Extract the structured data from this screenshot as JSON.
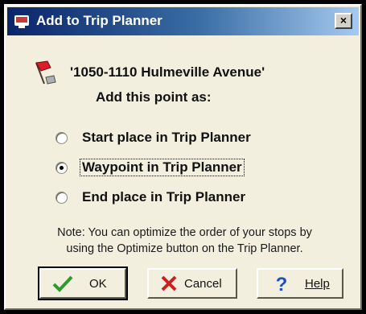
{
  "dialog": {
    "title": "Add to Trip Planner",
    "close_glyph": "×",
    "title_icon": "trip-planner-icon"
  },
  "location": {
    "address": "'1050-1110 Hulmeville Avenue'",
    "icon": "red-flag-icon"
  },
  "prompt": "Add this point as:",
  "options": [
    {
      "label": "Start place in Trip Planner",
      "selected": false
    },
    {
      "label": "Waypoint in Trip Planner",
      "selected": true
    },
    {
      "label": "End place in Trip Planner",
      "selected": false
    }
  ],
  "note_lines": [
    "Note: You can optimize the order of your stops by",
    "using the Optimize button on the Trip Planner."
  ],
  "buttons": {
    "ok": "OK",
    "cancel": "Cancel",
    "help": "Help"
  },
  "colors": {
    "title_start": "#0a246a",
    "title_end": "#a6caf0",
    "dialog_bg": "#f2efdf",
    "ok_check": "#2e9a2e",
    "cancel_x": "#cc2020",
    "help_q": "#1f4fc8"
  }
}
